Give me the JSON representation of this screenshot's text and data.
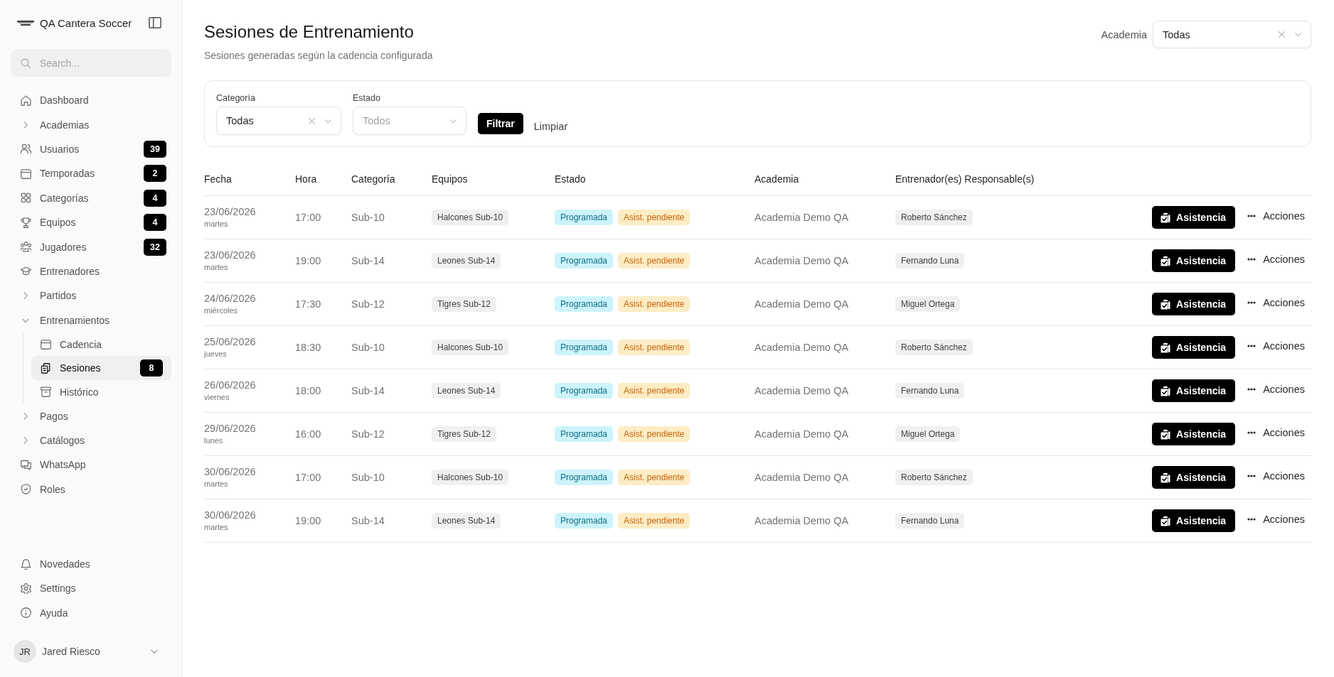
{
  "sidebar": {
    "brand": "QA Cantera Soccer",
    "search": {
      "placeholder": "Search..."
    },
    "nav": [
      {
        "kind": "link",
        "label": "Dashboard",
        "selected": false
      },
      {
        "kind": "group",
        "label": "Academias",
        "expanded": false,
        "selected": false
      },
      {
        "kind": "link",
        "label": "Usuarios",
        "badge": "39",
        "selected": false
      },
      {
        "kind": "link",
        "label": "Temporadas",
        "badge": "2",
        "selected": false
      },
      {
        "kind": "link",
        "label": "Categorías",
        "badge": "4",
        "selected": false
      },
      {
        "kind": "link",
        "label": "Equipos",
        "badge": "4",
        "selected": false
      },
      {
        "kind": "link",
        "label": "Jugadores",
        "badge": "32",
        "selected": false
      },
      {
        "kind": "link",
        "label": "Entrenadores",
        "selected": false
      },
      {
        "kind": "group",
        "label": "Partidos",
        "expanded": false,
        "selected": false
      },
      {
        "kind": "group",
        "label": "Entrenamientos",
        "expanded": true,
        "selected": false,
        "children": [
          {
            "kind": "link",
            "label": "Cadencia",
            "selected": false
          },
          {
            "kind": "link",
            "label": "Sesiones",
            "badge": "8",
            "selected": true
          },
          {
            "kind": "link",
            "label": "Histórico",
            "selected": false
          }
        ]
      },
      {
        "kind": "group",
        "label": "Pagos",
        "expanded": false,
        "selected": false
      },
      {
        "kind": "group",
        "label": "Catálogos",
        "expanded": false,
        "selected": false
      },
      {
        "kind": "link",
        "label": "WhatsApp",
        "selected": false
      },
      {
        "kind": "link",
        "label": "Roles",
        "selected": false
      }
    ],
    "footer_nav": [
      {
        "kind": "link",
        "label": "Novedades",
        "selected": false
      },
      {
        "kind": "link",
        "label": "Settings",
        "selected": false
      },
      {
        "kind": "link",
        "label": "Ayuda",
        "selected": false
      }
    ],
    "user": {
      "initials": "JR",
      "name": "Jared Riesco"
    }
  },
  "header": {
    "title": "Sesiones de Entrenamiento",
    "subtitle": "Sesiones generadas según la cadencia configurada",
    "academy_filter": {
      "label": "Academia",
      "value": "Todas"
    }
  },
  "filters": {
    "fields": [
      {
        "label": "Categoría",
        "value": "Todas"
      },
      {
        "label": "Estado",
        "placeholder": "Todos"
      }
    ],
    "buttons": [
      {
        "kind": "primary",
        "label": "Filtrar"
      },
      {
        "kind": "link",
        "label": "Limpiar"
      }
    ]
  },
  "table": {
    "columns": [
      "Fecha",
      "Hora",
      "Categoría",
      "Equipos",
      "Estado",
      "Academia",
      "Entrenador(es) Responsable(s)"
    ],
    "rows": [
      {
        "date": "23/06/2026",
        "weekday": "martes",
        "time": "17:00",
        "category": "Sub-10",
        "team": "Halcones Sub-10",
        "statuses": [
          {
            "kind": "scheduled",
            "label": "Programada"
          },
          {
            "kind": "pending",
            "label": "Asist. pendiente"
          }
        ],
        "academy": "Academia Demo QA",
        "coaches": [
          "Roberto Sánchez"
        ],
        "attendance_button": "Asistencia",
        "actions": "Acciones"
      },
      {
        "date": "23/06/2026",
        "weekday": "martes",
        "time": "19:00",
        "category": "Sub-14",
        "team": "Leones Sub-14",
        "statuses": [
          {
            "kind": "scheduled",
            "label": "Programada"
          },
          {
            "kind": "pending",
            "label": "Asist. pendiente"
          }
        ],
        "academy": "Academia Demo QA",
        "coaches": [
          "Fernando Luna"
        ],
        "attendance_button": "Asistencia",
        "actions": "Acciones"
      },
      {
        "date": "24/06/2026",
        "weekday": "miércoles",
        "time": "17:30",
        "category": "Sub-12",
        "team": "Tigres Sub-12",
        "statuses": [
          {
            "kind": "scheduled",
            "label": "Programada"
          },
          {
            "kind": "pending",
            "label": "Asist. pendiente"
          }
        ],
        "academy": "Academia Demo QA",
        "coaches": [
          "Miguel Ortega"
        ],
        "attendance_button": "Asistencia",
        "actions": "Acciones"
      },
      {
        "date": "25/06/2026",
        "weekday": "jueves",
        "time": "18:30",
        "category": "Sub-10",
        "team": "Halcones Sub-10",
        "statuses": [
          {
            "kind": "scheduled",
            "label": "Programada"
          },
          {
            "kind": "pending",
            "label": "Asist. pendiente"
          }
        ],
        "academy": "Academia Demo QA",
        "coaches": [
          "Roberto Sánchez"
        ],
        "attendance_button": "Asistencia",
        "actions": "Acciones"
      },
      {
        "date": "26/06/2026",
        "weekday": "viernes",
        "time": "18:00",
        "category": "Sub-14",
        "team": "Leones Sub-14",
        "statuses": [
          {
            "kind": "scheduled",
            "label": "Programada"
          },
          {
            "kind": "pending",
            "label": "Asist. pendiente"
          }
        ],
        "academy": "Academia Demo QA",
        "coaches": [
          "Fernando Luna"
        ],
        "attendance_button": "Asistencia",
        "actions": "Acciones"
      },
      {
        "date": "29/06/2026",
        "weekday": "lunes",
        "time": "16:00",
        "category": "Sub-12",
        "team": "Tigres Sub-12",
        "statuses": [
          {
            "kind": "scheduled",
            "label": "Programada"
          },
          {
            "kind": "pending",
            "label": "Asist. pendiente"
          }
        ],
        "academy": "Academia Demo QA",
        "coaches": [
          "Miguel Ortega"
        ],
        "attendance_button": "Asistencia",
        "actions": "Acciones"
      },
      {
        "date": "30/06/2026",
        "weekday": "martes",
        "time": "17:00",
        "category": "Sub-10",
        "team": "Halcones Sub-10",
        "statuses": [
          {
            "kind": "scheduled",
            "label": "Programada"
          },
          {
            "kind": "pending",
            "label": "Asist. pendiente"
          }
        ],
        "academy": "Academia Demo QA",
        "coaches": [
          "Roberto Sánchez"
        ],
        "attendance_button": "Asistencia",
        "actions": "Acciones"
      },
      {
        "date": "30/06/2026",
        "weekday": "martes",
        "time": "19:00",
        "category": "Sub-14",
        "team": "Leones Sub-14",
        "statuses": [
          {
            "kind": "scheduled",
            "label": "Programada"
          },
          {
            "kind": "pending",
            "label": "Asist. pendiente"
          }
        ],
        "academy": "Academia Demo QA",
        "coaches": [
          "Fernando Luna"
        ],
        "attendance_button": "Asistencia",
        "actions": "Acciones"
      }
    ]
  }
}
